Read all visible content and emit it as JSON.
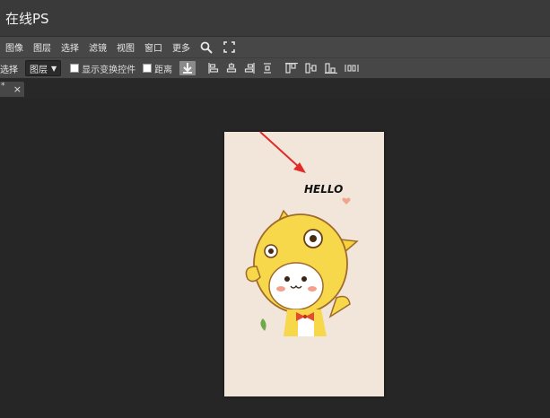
{
  "app": {
    "title": "在线PS"
  },
  "menu": {
    "items": [
      "图像",
      "图层",
      "选择",
      "滤镜",
      "视图",
      "窗口",
      "更多"
    ]
  },
  "toolbar": {
    "select_label": "选择",
    "layer_dropdown": "图层",
    "show_transform": "显示变换控件",
    "distance": "距离"
  },
  "tab": {
    "close_glyph": "×"
  },
  "artwork": {
    "text": "HELLO"
  },
  "colors": {
    "arrow": "#e12a2a",
    "canvas_bg": "#f2e6da"
  }
}
